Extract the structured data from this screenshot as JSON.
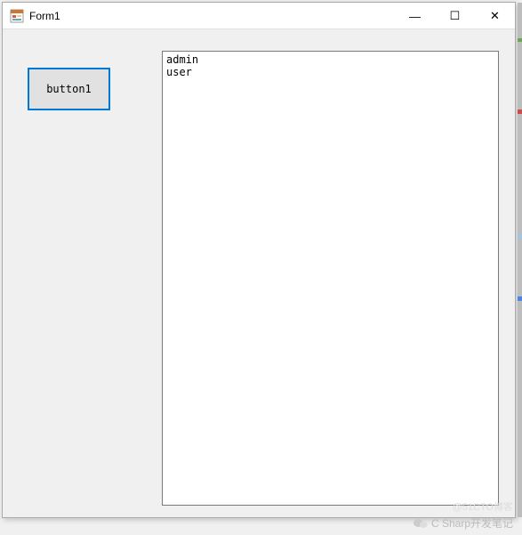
{
  "window": {
    "title": "Form1",
    "controls": {
      "minimize": "—",
      "maximize": "☐",
      "close": "✕"
    }
  },
  "button1": {
    "label": "button1"
  },
  "textbox": {
    "content": "admin\nuser"
  },
  "watermark": {
    "text": "C Sharp开发笔记",
    "sub": "@51CTO博客"
  }
}
